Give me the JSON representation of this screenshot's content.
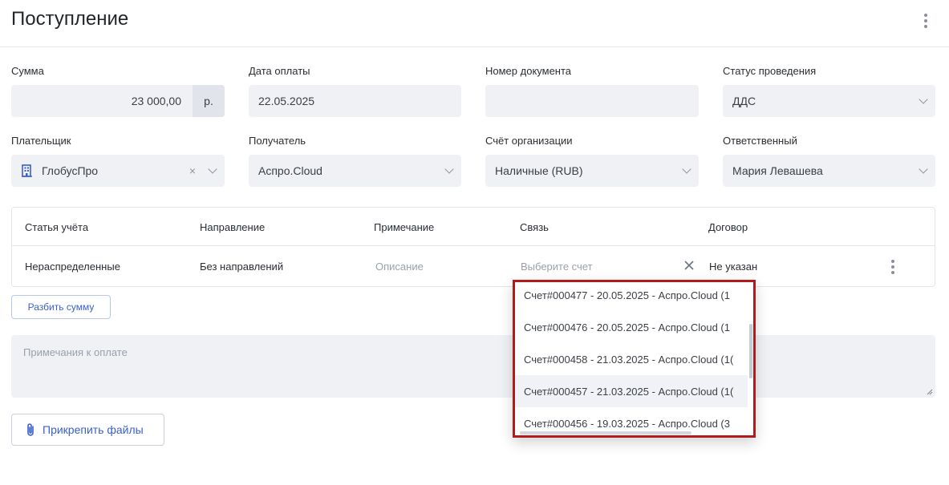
{
  "header": {
    "title": "Поступление"
  },
  "row1": {
    "sum": {
      "label": "Сумма",
      "value": "23 000,00",
      "currency": "р."
    },
    "payment_date": {
      "label": "Дата оплаты",
      "value": "22.05.2025"
    },
    "doc_number": {
      "label": "Номер документа",
      "value": ""
    },
    "status": {
      "label": "Статус проведения",
      "value": "ДДС"
    }
  },
  "row2": {
    "payer": {
      "label": "Плательщик",
      "value": "ГлобусПро"
    },
    "recipient": {
      "label": "Получатель",
      "value": "Аспро.Cloud"
    },
    "account": {
      "label": "Счёт организации",
      "value": "Наличные (RUB)"
    },
    "responsible": {
      "label": "Ответственный",
      "value": "Мария Левашева"
    }
  },
  "table": {
    "headers": [
      "Статья учёта",
      "Направление",
      "Примечание",
      "Связь",
      "Договор"
    ],
    "row": {
      "article": "Нераспределенные",
      "direction": "Без направлений",
      "note_placeholder": "Описание",
      "link_placeholder": "Выберите счет",
      "contract": "Не указан"
    }
  },
  "split_button": "Разбить сумму",
  "notes_placeholder": "Примечания к оплате",
  "attach_button": "Прикрепить файлы",
  "dropdown": {
    "items": [
      "Счет#000477 - 20.05.2025 - Аспро.Cloud (1",
      "Счет#000476 - 20.05.2025 - Аспро.Cloud (1",
      "Счет#000458 - 21.03.2025 - Аспро.Cloud (1(",
      "Счет#000457 - 21.03.2025 - Аспро.Cloud (1(",
      "Счет#000456 - 19.03.2025 - Аспро.Cloud (3"
    ],
    "hovered_index": 3
  },
  "colors": {
    "accent": "#3a5fcd",
    "highlight_border": "#b01c1c",
    "field_bg": "#eff1f5"
  }
}
